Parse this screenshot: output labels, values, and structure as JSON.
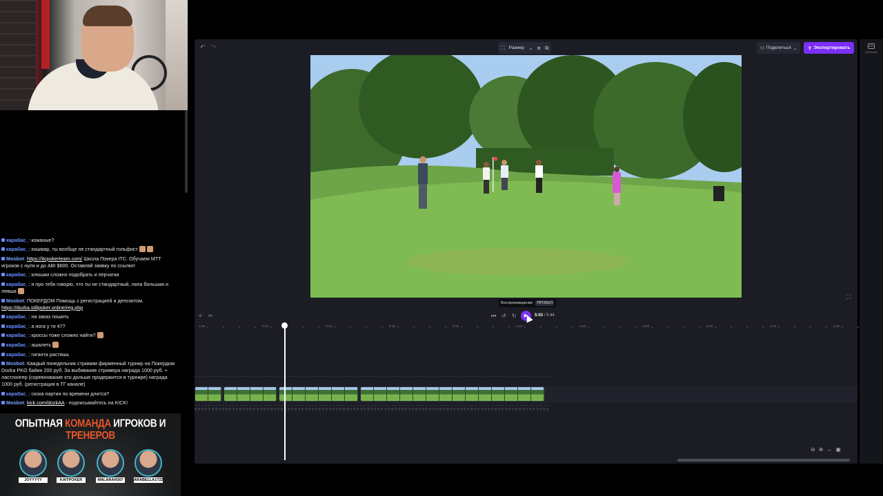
{
  "chat": {
    "messages": [
      {
        "author": "карабас_",
        "text": "кожаные?",
        "bot": false
      },
      {
        "author": "карабас_",
        "text": "кошмар, ты вообще не стандартный гольфист",
        "bot": false,
        "emotes": 2
      },
      {
        "author": "Moobot",
        "link": "https://itcpokerteam.com/",
        "text": " Школа Покера ITC. Обучаем МТТ игроков с нуля и до ABI $600. Оставляй заявку по ссылке!",
        "bot": true
      },
      {
        "author": "карабас_",
        "text": "клюшки сложно подобрать и перчатки",
        "bot": false
      },
      {
        "author": "карабас_",
        "text": "я про тебя говорю, что ты не стандартный, лапа большая и левша",
        "bot": false,
        "emotes": 1
      },
      {
        "author": "Moobot",
        "text": "ПОКЕРДОМ Помощь с регистрацией и депозитом.",
        "link2": "https://dozka.stillpoker.online/reg.php",
        "bot": true
      },
      {
        "author": "карабас_",
        "text": "на заказ пошить",
        "bot": false
      },
      {
        "author": "карабас_",
        "text": "а нога у тя 47?",
        "bot": false
      },
      {
        "author": "карабас_",
        "text": "кроссы тоже сложно найти?",
        "bot": false,
        "emotes": 1
      },
      {
        "author": "карабас_",
        "text": "ашалеть",
        "bot": false,
        "emotes": 1
      },
      {
        "author": "карабас_",
        "text": "гиганта растишь",
        "bot": false
      },
      {
        "author": "Moobot",
        "text": "Каждый понедельник стримим фирменный турнир на Покердом Dozka PKO байин 200 руб. За выбивание стримера награда 1000 руб. + ластлонгер (соревнование кто дольше продержится в турнире) награда 1000 руб. (регистрация в ТГ канале)",
        "bot": true
      },
      {
        "author": "карабас_",
        "text": "скока партия по времени длится?",
        "bot": false
      },
      {
        "author": "Moobot",
        "link": "kick.com/dozkAA",
        "text": " - подписывайтесь на KICK!",
        "bot": true
      }
    ]
  },
  "promo": {
    "title_part1": "ОПЫТНАЯ ",
    "title_accent1": "КОМАНДА",
    "title_part2": " ИГРОКОВ И ",
    "title_accent2": "ТРЕНЕРОВ",
    "players": [
      "JOYYYYY",
      "KAITPOKER",
      "MALARAH367",
      "ARABELLA1722"
    ]
  },
  "editor": {
    "size_label": "Размер",
    "share_label": "Поделиться",
    "export_label": "Экспортировать",
    "captions_label": "Субтитры",
    "tooltip_label": "Воспроизведение",
    "tooltip_key": "ПРОБЕЛ",
    "current_time": "5:03",
    "total_time": "5:44",
    "ruler_ticks": [
      "4:50",
      "5:00",
      "5:10",
      "5:20",
      "5:30",
      "5:40",
      "5:50",
      "6:00",
      "6:10",
      "6:20",
      "6:30"
    ],
    "playhead_time": "5:03",
    "clips_frames": [
      2,
      4,
      6,
      14
    ]
  },
  "colors": {
    "accent": "#7b2ff7",
    "editor_bg": "#1b1c24",
    "chat_author": "#6b8fff"
  }
}
